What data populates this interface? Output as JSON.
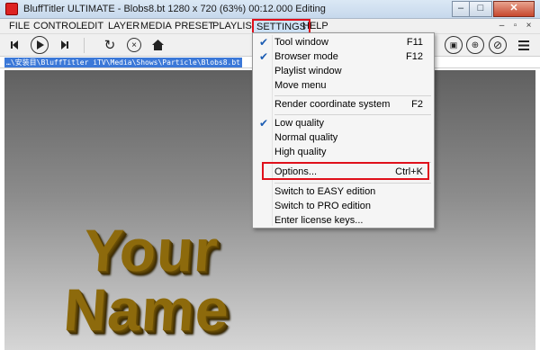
{
  "window": {
    "title": "BluffTitler ULTIMATE  -  Blobs8.bt 1280 x 720 (63%) 00:12.000 Editing",
    "minimize_glyph": "–",
    "restore_glyph": "□",
    "close_glyph": "✕"
  },
  "menubar": {
    "items": [
      "FILE",
      "CONTROL",
      "EDIT",
      "LAYER",
      "MEDIA",
      "PRESET",
      "PLAYLIST",
      "SETTINGS",
      "HELP"
    ],
    "active": "SETTINGS",
    "small_min": "–",
    "small_restore": "▫",
    "small_close": "×"
  },
  "toolbar": {
    "icons": [
      "skip-back-icon",
      "play-icon",
      "skip-forward-icon",
      "refresh-icon",
      "stop-icon",
      "home-icon",
      "camera-icon",
      "target-icon",
      "no-symbol-icon",
      "hamburger-menu-icon"
    ]
  },
  "pathbar": {
    "path": "…\\安装目\\BluffTitler iTV\\Media\\Shows\\Particle\\Blobs8.bt"
  },
  "canvas": {
    "line1": "Your",
    "line2": "Name",
    "text_color": "#8d6a0c"
  },
  "settings_menu": {
    "items": [
      {
        "label": "Tool window",
        "shortcut": "F11",
        "checked": true
      },
      {
        "label": "Browser mode",
        "shortcut": "F12",
        "checked": true
      },
      {
        "label": "Playlist window",
        "shortcut": "",
        "checked": false
      },
      {
        "label": "Move menu",
        "shortcut": "",
        "checked": false
      },
      {
        "label": "Render coordinate system",
        "shortcut": "F2",
        "checked": false
      },
      {
        "label": "Low quality",
        "shortcut": "",
        "checked": true
      },
      {
        "label": "Normal quality",
        "shortcut": "",
        "checked": false
      },
      {
        "label": "High quality",
        "shortcut": "",
        "checked": false
      },
      {
        "label": "Options...",
        "shortcut": "Ctrl+K",
        "checked": false
      },
      {
        "label": "Switch to EASY edition",
        "shortcut": "",
        "checked": false
      },
      {
        "label": "Switch to PRO edition",
        "shortcut": "",
        "checked": false
      },
      {
        "label": "Enter license keys...",
        "shortcut": "",
        "checked": false
      }
    ],
    "check_glyph": "✔",
    "highlighted_item": "Options...",
    "highlight_color": "#e0101b"
  }
}
